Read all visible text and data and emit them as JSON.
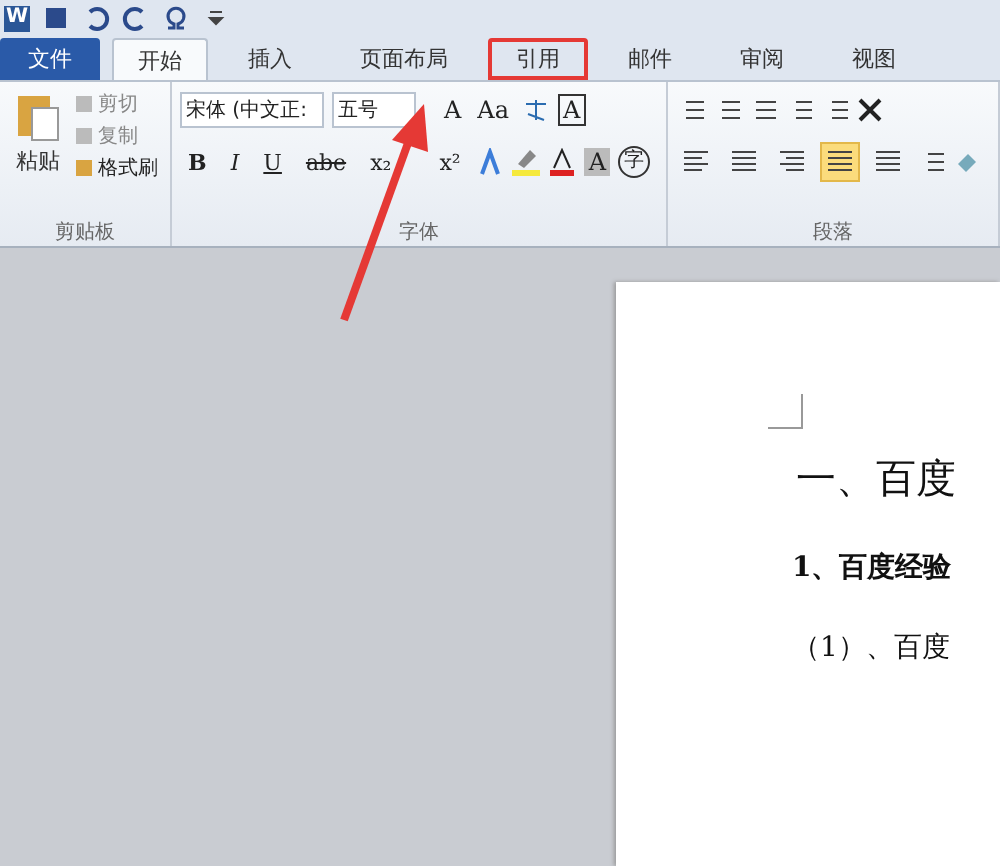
{
  "quick_access": {
    "app_icon": "W"
  },
  "tabs": [
    {
      "label": "文件",
      "kind": "file",
      "selected": false,
      "highlighted": false
    },
    {
      "label": "开始",
      "kind": "tab",
      "selected": true,
      "highlighted": false
    },
    {
      "label": "插入",
      "kind": "tab",
      "selected": false,
      "highlighted": false
    },
    {
      "label": "页面布局",
      "kind": "tab",
      "selected": false,
      "highlighted": false
    },
    {
      "label": "引用",
      "kind": "tab",
      "selected": false,
      "highlighted": true
    },
    {
      "label": "邮件",
      "kind": "tab",
      "selected": false,
      "highlighted": false
    },
    {
      "label": "审阅",
      "kind": "tab",
      "selected": false,
      "highlighted": false
    },
    {
      "label": "视图",
      "kind": "tab",
      "selected": false,
      "highlighted": false
    }
  ],
  "clipboard": {
    "paste": "粘贴",
    "items": [
      "剪切",
      "复制",
      "格式刷"
    ],
    "group": "剪贴板"
  },
  "font": {
    "name": "宋体 (中文正:",
    "size": "五号",
    "grow": "A",
    "case": "Aa",
    "border_char": "A",
    "shade_char": "A",
    "enclose_char": "字",
    "format_buttons": [
      "B",
      "I",
      "U",
      "abe",
      "x₂",
      "x²"
    ],
    "group": "字体"
  },
  "paragraph": {
    "group": "段落",
    "align": [
      {
        "selected": false
      },
      {
        "selected": false
      },
      {
        "selected": false
      },
      {
        "selected": true
      },
      {
        "selected": false
      }
    ]
  },
  "document": {
    "lines": [
      {
        "text": "一、百度",
        "kind": "heading"
      },
      {
        "text": "1、百度经验",
        "kind": "sub"
      },
      {
        "text": "（1）、百度",
        "kind": "item"
      }
    ]
  }
}
